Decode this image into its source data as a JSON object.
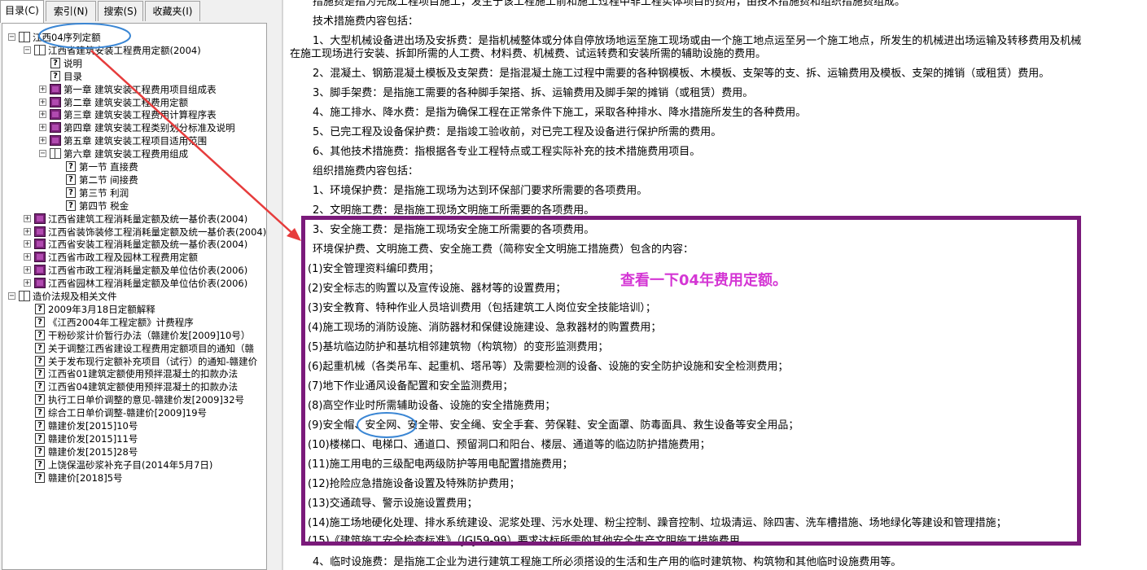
{
  "tabs": [
    "目录(C)",
    "索引(N)",
    "搜索(S)",
    "收藏夹(I)"
  ],
  "tree": [
    {
      "depth": 0,
      "pm": "−",
      "icon": "book-open",
      "label": "江西04序列定额"
    },
    {
      "depth": 1,
      "pm": "−",
      "icon": "book-open",
      "label": "江西省建筑安装工程费用定额(2004)"
    },
    {
      "depth": 2,
      "pm": "",
      "icon": "help-page",
      "label": "说明"
    },
    {
      "depth": 2,
      "pm": "",
      "icon": "help-page",
      "label": "目录"
    },
    {
      "depth": 2,
      "pm": "+",
      "icon": "book-closed",
      "label": "第一章 建筑安装工程费用项目组成表"
    },
    {
      "depth": 2,
      "pm": "+",
      "icon": "book-closed",
      "label": "第二章 建筑安装工程费用定额"
    },
    {
      "depth": 2,
      "pm": "+",
      "icon": "book-closed",
      "label": "第三章 建筑安装工程费用计算程序表"
    },
    {
      "depth": 2,
      "pm": "+",
      "icon": "book-closed",
      "label": "第四章 建筑安装工程类别划分标准及说明"
    },
    {
      "depth": 2,
      "pm": "+",
      "icon": "book-closed",
      "label": "第五章 建筑安装工程项目适用范围"
    },
    {
      "depth": 2,
      "pm": "−",
      "icon": "book-open",
      "label": "第六章 建筑安装工程费用组成"
    },
    {
      "depth": 3,
      "pm": "",
      "icon": "help-page",
      "label": "第一节 直接费"
    },
    {
      "depth": 3,
      "pm": "",
      "icon": "help-page",
      "label": "第二节 间接费"
    },
    {
      "depth": 3,
      "pm": "",
      "icon": "help-page",
      "label": "第三节 利润"
    },
    {
      "depth": 3,
      "pm": "",
      "icon": "help-page",
      "label": "第四节 税金"
    },
    {
      "depth": 1,
      "pm": "+",
      "icon": "book-closed",
      "label": "江西省建筑工程消耗量定额及统一基价表(2004)"
    },
    {
      "depth": 1,
      "pm": "+",
      "icon": "book-closed",
      "label": "江西省装饰装修工程消耗量定额及统一基价表(2004)"
    },
    {
      "depth": 1,
      "pm": "+",
      "icon": "book-closed",
      "label": "江西省安装工程消耗量定额及统一基价表(2004)"
    },
    {
      "depth": 1,
      "pm": "+",
      "icon": "book-closed",
      "label": "江西省市政工程及园林工程费用定额"
    },
    {
      "depth": 1,
      "pm": "+",
      "icon": "book-closed",
      "label": "江西省市政工程消耗量定额及单位估价表(2006)"
    },
    {
      "depth": 1,
      "pm": "+",
      "icon": "book-closed",
      "label": "江西省园林工程消耗量定额及单位估价表(2006)"
    },
    {
      "depth": 0,
      "pm": "−",
      "icon": "book-open",
      "label": "造价法规及相关文件"
    },
    {
      "depth": 1,
      "pm": "",
      "icon": "help-page",
      "label": "2009年3月18日定额解释"
    },
    {
      "depth": 1,
      "pm": "",
      "icon": "help-page",
      "label": "《江西2004年工程定额》计费程序"
    },
    {
      "depth": 1,
      "pm": "",
      "icon": "help-page",
      "label": "干粉砂浆计价暂行办法（赣建价发[2009]10号）"
    },
    {
      "depth": 1,
      "pm": "",
      "icon": "help-page",
      "label": "关于调整江西省建设工程费用定额项目的通知（赣"
    },
    {
      "depth": 1,
      "pm": "",
      "icon": "help-page",
      "label": "关于发布现行定额补充项目（试行）的通知-赣建价"
    },
    {
      "depth": 1,
      "pm": "",
      "icon": "help-page",
      "label": "江西省01建筑定额使用预拌混凝土的扣款办法"
    },
    {
      "depth": 1,
      "pm": "",
      "icon": "help-page",
      "label": "江西省04建筑定额使用预拌混凝土的扣款办法"
    },
    {
      "depth": 1,
      "pm": "",
      "icon": "help-page",
      "label": "执行工日单价调整的意见-赣建价发[2009]32号"
    },
    {
      "depth": 1,
      "pm": "",
      "icon": "help-page",
      "label": "综合工日单价调整-赣建价[2009]19号"
    },
    {
      "depth": 1,
      "pm": "",
      "icon": "help-page",
      "label": "赣建价发[2015]10号"
    },
    {
      "depth": 1,
      "pm": "",
      "icon": "help-page",
      "label": "赣建价发[2015]11号"
    },
    {
      "depth": 1,
      "pm": "",
      "icon": "help-page",
      "label": "赣建价发[2015]28号"
    },
    {
      "depth": 1,
      "pm": "",
      "icon": "help-page",
      "label": "上饶保温砂浆补充子目(2014年5月7日)"
    },
    {
      "depth": 1,
      "pm": "",
      "icon": "help-page",
      "label": "赣建价[2018]5号"
    }
  ],
  "content_lines": [
    "措施费是指为完成工程项目施工，发生于该工程施工前和施工过程中非工程实体项目的费用，由技术措施费和组织措施费组成。",
    "技术措施费内容包括：",
    "1、大型机械设备进出场及安拆费：是指机械整体或分体自停放场地运至施工现场或由一个施工地点运至另一个施工地点，所发生的机械进出场运输及转移费用及机械",
    "在施工现场进行安装、拆卸所需的人工费、材料费、机械费、试运转费和安装所需的辅助设施的费用。",
    "2、混凝土、钢筋混凝土模板及支架费：是指混凝土施工过程中需要的各种钢模板、木模板、支架等的支、拆、运输费用及模板、支架的摊销（或租赁）费用。",
    "3、脚手架费：是指施工需要的各种脚手架搭、拆、运输费用及脚手架的摊销（或租赁）费用。",
    "4、施工排水、降水费：是指为确保工程在正常条件下施工，采取各种排水、降水措施所发生的各种费用。",
    "5、已完工程及设备保护费：是指竣工验收前，对已完工程及设备进行保护所需的费用。",
    "6、其他技术措施费：指根据各专业工程特点或工程实际补充的技术措施费用项目。",
    "组织措施费内容包括：",
    "1、环境保护费：是指施工现场为达到环保部门要求所需要的各项费用。",
    "2、文明施工费：是指施工现场文明施工所需要的各项费用。",
    "3、安全施工费：是指施工现场安全施工所需要的各项费用。",
    "环境保护费、文明施工费、安全施工费（简称安全文明施工措施费）包含的内容：",
    "(1)安全管理资料编印费用；",
    "(2)安全标志的购置以及宣传设施、器材等的设置费用；",
    "(3)安全教育、特种作业人员培训费用（包括建筑工人岗位安全技能培训）；",
    "(4)施工现场的消防设施、消防器材和保健设施建设、急救器材的购置费用；",
    "(5)基坑临边防护和基坑相邻建筑物（构筑物）的变形监测费用；",
    "(6)起重机械（各类吊车、起重机、塔吊等）及需要检测的设备、设施的安全防护设施和安全检测费用；",
    "(7)地下作业通风设备配置和安全监测费用；",
    "(8)高空作业时所需辅助设备、设施的安全措施费用；",
    "(9)安全帽、安全网、安全带、安全绳、安全手套、劳保鞋、安全面罩、防毒面具、救生设备等安全用品；",
    "(10)楼梯口、电梯口、通道口、预留洞口和阳台、楼层、通道等的临边防护措施费用；",
    "(11)施工用电的三级配电两级防护等用电配置措施费用；",
    "(12)抢险应急措施设备设置及特殊防护费用；",
    "(13)交通疏导、警示设施设置费用；",
    "(14)施工场地硬化处理、排水系统建设、泥浆处理、污水处理、粉尘控制、躁音控制、垃圾清运、除四害、洗车槽措施、场地绿化等建设和管理措施；",
    "(15)《建筑施工安全检查标准》（JGJ59-99）要求达标所需的其他安全生产文明施工措施费用。",
    "4、临时设施费：是指施工企业为进行建筑工程施工所必须搭设的生活和生产用的临时建筑物、构筑物和其他临时设施费用等。"
  ],
  "annotation_note": "查看一下04年费用定额。",
  "colors": {
    "highlight_box": "#7a1a7a",
    "note_text": "#d436d4",
    "circle": "#3a86d4",
    "arrow": "#e63c3c"
  }
}
